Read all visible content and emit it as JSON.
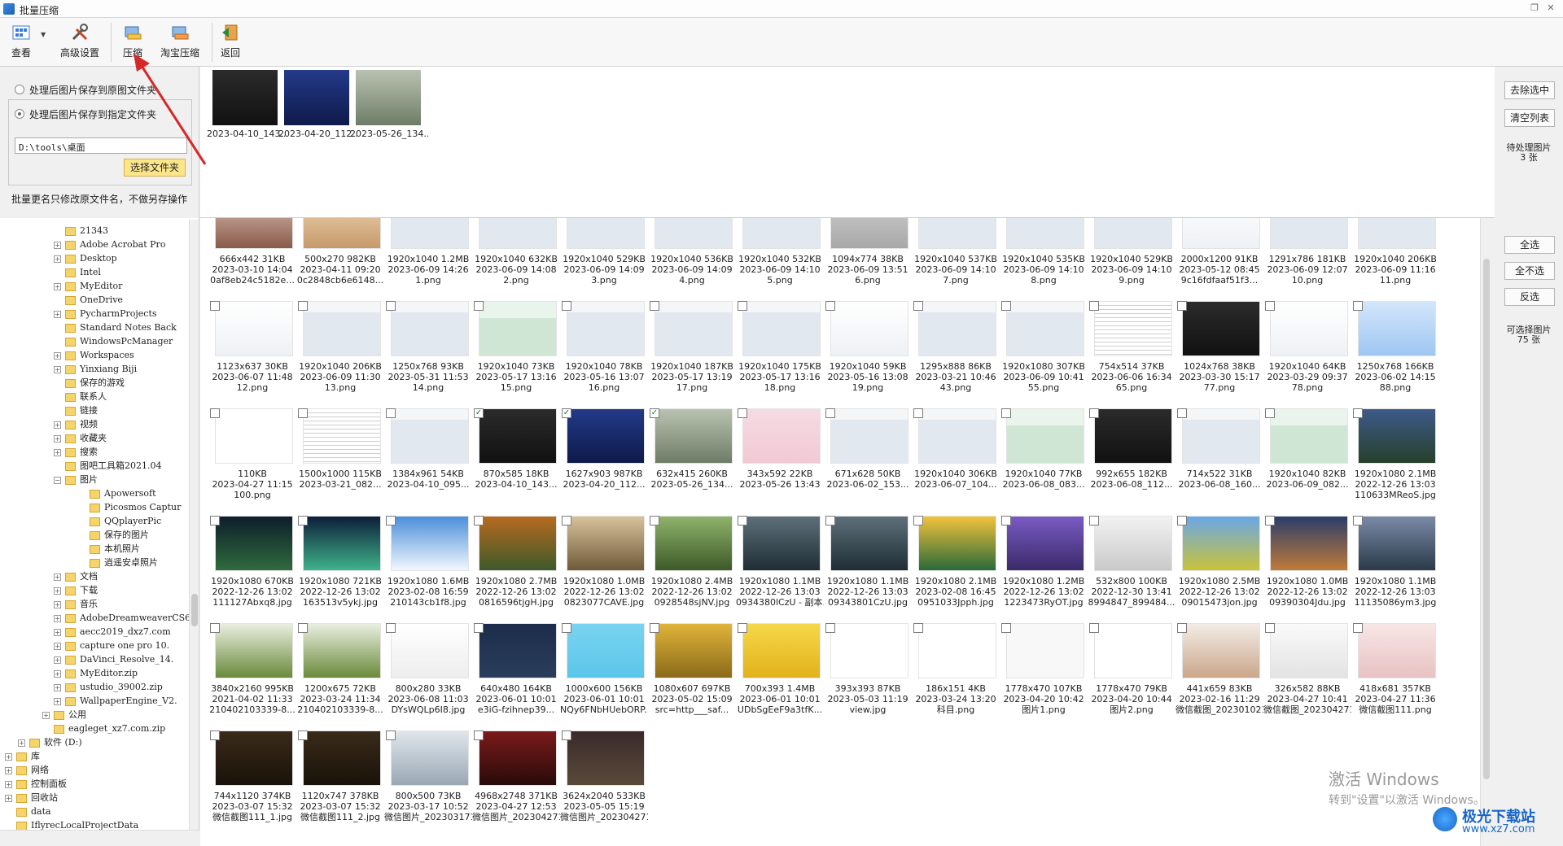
{
  "window": {
    "title": "批量压缩"
  },
  "toolbar": {
    "view_label": "查看",
    "advanced_label": "高级设置",
    "compress_label": "压缩",
    "taobao_label": "淘宝压缩",
    "back_label": "返回"
  },
  "options": {
    "save_original_label": "处理后图片保存到原图文件夹",
    "save_custom_label": "处理后图片保存到指定文件夹",
    "path_value": "D:\\tools\\桌面",
    "choose_folder_label": "选择文件夹",
    "rename_note": "批量更名只修改原文件名，不做另存操作"
  },
  "queue": {
    "items": [
      "2023-04-10_143...",
      "2023-04-20_112...",
      "2023-05-26_134..."
    ],
    "remove_selected_label": "去除选中",
    "clear_list_label": "清空列表",
    "pending_label": "待处理图片",
    "pending_count": "3 张"
  },
  "grid_controls": {
    "select_all_label": "全选",
    "select_none_label": "全不选",
    "invert_label": "反选",
    "selectable_label": "可选择图片",
    "selectable_count": "75 张"
  },
  "tree": [
    {
      "label": "21343",
      "indent": 1,
      "exp": ""
    },
    {
      "label": "Adobe Acrobat Pro",
      "indent": 1,
      "exp": "+"
    },
    {
      "label": "Desktop",
      "indent": 1,
      "exp": "+"
    },
    {
      "label": "Intel",
      "indent": 1,
      "exp": ""
    },
    {
      "label": "MyEditor",
      "indent": 1,
      "exp": "+"
    },
    {
      "label": "OneDrive",
      "indent": 1,
      "exp": ""
    },
    {
      "label": "PycharmProjects",
      "indent": 1,
      "exp": "+"
    },
    {
      "label": "Standard Notes Back",
      "indent": 1,
      "exp": ""
    },
    {
      "label": "WindowsPcManager",
      "indent": 1,
      "exp": ""
    },
    {
      "label": "Workspaces",
      "indent": 1,
      "exp": "+"
    },
    {
      "label": "Yinxiang Biji",
      "indent": 1,
      "exp": "+"
    },
    {
      "label": "保存的游戏",
      "indent": 1,
      "exp": ""
    },
    {
      "label": "联系人",
      "indent": 1,
      "exp": ""
    },
    {
      "label": "链接",
      "indent": 1,
      "exp": ""
    },
    {
      "label": "视频",
      "indent": 1,
      "exp": "+"
    },
    {
      "label": "收藏夹",
      "indent": 1,
      "exp": "+"
    },
    {
      "label": "搜索",
      "indent": 1,
      "exp": "+"
    },
    {
      "label": "图吧工具箱2021.04",
      "indent": 1,
      "exp": ""
    },
    {
      "label": "图片",
      "indent": 1,
      "exp": "-"
    },
    {
      "label": "Apowersoft",
      "indent": 2,
      "exp": ""
    },
    {
      "label": "Picosmos Captur",
      "indent": 2,
      "exp": ""
    },
    {
      "label": "QQplayerPic",
      "indent": 2,
      "exp": ""
    },
    {
      "label": "保存的图片",
      "indent": 2,
      "exp": ""
    },
    {
      "label": "本机照片",
      "indent": 2,
      "exp": ""
    },
    {
      "label": "逍遥安卓照片",
      "indent": 2,
      "exp": ""
    },
    {
      "label": "文档",
      "indent": 1,
      "exp": "+"
    },
    {
      "label": "下载",
      "indent": 1,
      "exp": "+"
    },
    {
      "label": "音乐",
      "indent": 1,
      "exp": "+"
    },
    {
      "label": "AdobeDreamweaverCS6",
      "indent": 1,
      "exp": "+"
    },
    {
      "label": "aecc2019_dxz7.com",
      "indent": 1,
      "exp": "+"
    },
    {
      "label": "capture one pro 10.",
      "indent": 1,
      "exp": "+"
    },
    {
      "label": "DaVinci_Resolve_14.",
      "indent": 1,
      "exp": "+"
    },
    {
      "label": "MyEditor.zip",
      "indent": 1,
      "exp": "+"
    },
    {
      "label": "ustudio_39002.zip",
      "indent": 1,
      "exp": "+"
    },
    {
      "label": "WallpaperEngine_V2.",
      "indent": 1,
      "exp": "+"
    },
    {
      "label": "公用",
      "indent": 0,
      "exp": "+"
    },
    {
      "label": "eagleget_xz7.com.zip",
      "indent": 0,
      "exp": ""
    },
    {
      "label": "软件 (D:)",
      "indent": -1,
      "exp": "+"
    },
    {
      "label": "库",
      "indent": -2,
      "exp": "+"
    },
    {
      "label": "网络",
      "indent": -2,
      "exp": "+"
    },
    {
      "label": "控制面板",
      "indent": -2,
      "exp": "+"
    },
    {
      "label": "回收站",
      "indent": -2,
      "exp": "+"
    },
    {
      "label": "data",
      "indent": -2,
      "exp": ""
    },
    {
      "label": "IflyrecLocalProjectData",
      "indent": -2,
      "exp": ""
    }
  ],
  "grid": [
    {
      "dim": "666x442 31KB",
      "date": "2023-03-10 14:04",
      "name": "0af8eb24c5182e...",
      "thumb": "portrait",
      "checked": false
    },
    {
      "dim": "500x270 982KB",
      "date": "2023-04-11 09:20",
      "name": "0c2848cb6e6148...",
      "thumb": "warm",
      "checked": false
    },
    {
      "dim": "1920x1040 1.2MB",
      "date": "2023-06-09 14:26",
      "name": "1.png",
      "thumb": "screen",
      "checked": false
    },
    {
      "dim": "1920x1040 632KB",
      "date": "2023-06-09 14:08",
      "name": "2.png",
      "thumb": "screen",
      "checked": false
    },
    {
      "dim": "1920x1040 529KB",
      "date": "2023-06-09 14:09",
      "name": "3.png",
      "thumb": "screen",
      "checked": false
    },
    {
      "dim": "1920x1040 536KB",
      "date": "2023-06-09 14:09",
      "name": "4.png",
      "thumb": "screen",
      "checked": false
    },
    {
      "dim": "1920x1040 532KB",
      "date": "2023-06-09 14:10",
      "name": "5.png",
      "thumb": "screen",
      "checked": false
    },
    {
      "dim": "1094x774 38KB",
      "date": "2023-06-09 13:51",
      "name": "6.png",
      "thumb": "gray",
      "checked": false
    },
    {
      "dim": "1920x1040 537KB",
      "date": "2023-06-09 14:10",
      "name": "7.png",
      "thumb": "screen",
      "checked": false
    },
    {
      "dim": "1920x1040 535KB",
      "date": "2023-06-09 14:10",
      "name": "8.png",
      "thumb": "screen",
      "checked": false
    },
    {
      "dim": "1920x1040 529KB",
      "date": "2023-06-09 14:10",
      "name": "9.png",
      "thumb": "screen",
      "checked": false
    },
    {
      "dim": "2000x1200 91KB",
      "date": "2023-05-12 08:45",
      "name": "9c16fdfaaf51f3...",
      "thumb": "white",
      "checked": false
    },
    {
      "dim": "1291x786 181KB",
      "date": "2023-06-09 12:07",
      "name": "10.png",
      "thumb": "screen",
      "checked": false
    },
    {
      "dim": "1920x1040 206KB",
      "date": "2023-06-09 11:16",
      "name": "11.png",
      "thumb": "screen",
      "checked": false
    },
    {
      "dim": "1123x637 30KB",
      "date": "2023-06-07 11:48",
      "name": "12.png",
      "thumb": "white",
      "checked": false
    },
    {
      "dim": "1920x1040 206KB",
      "date": "2023-06-09 11:30",
      "name": "13.png",
      "thumb": "screen",
      "checked": false
    },
    {
      "dim": "1250x768 93KB",
      "date": "2023-05-31 11:53",
      "name": "14.png",
      "thumb": "screen",
      "checked": false
    },
    {
      "dim": "1920x1040 73KB",
      "date": "2023-05-17 13:16",
      "name": "15.png",
      "thumb": "greenui",
      "checked": false
    },
    {
      "dim": "1920x1040 78KB",
      "date": "2023-05-16 13:07",
      "name": "16.png",
      "thumb": "screen",
      "checked": false
    },
    {
      "dim": "1920x1040 187KB",
      "date": "2023-05-17 13:19",
      "name": "17.png",
      "thumb": "screen",
      "checked": false
    },
    {
      "dim": "1920x1040 175KB",
      "date": "2023-05-17 13:16",
      "name": "18.png",
      "thumb": "screen",
      "checked": false
    },
    {
      "dim": "1920x1040 59KB",
      "date": "2023-05-16 13:08",
      "name": "19.png",
      "thumb": "white",
      "checked": false
    },
    {
      "dim": "1295x888 86KB",
      "date": "2023-03-21 10:46",
      "name": "43.png",
      "thumb": "screen",
      "checked": false
    },
    {
      "dim": "1920x1080 307KB",
      "date": "2023-06-09 10:41",
      "name": "55.png",
      "thumb": "screen",
      "checked": false
    },
    {
      "dim": "754x514 37KB",
      "date": "2023-06-06 16:34",
      "name": "65.png",
      "thumb": "doc",
      "checked": false
    },
    {
      "dim": "1024x768 38KB",
      "date": "2023-03-30 15:17",
      "name": "77.png",
      "thumb": "dark",
      "checked": false
    },
    {
      "dim": "1920x1040 64KB",
      "date": "2023-03-29 09:37",
      "name": "78.png",
      "thumb": "white",
      "checked": false
    },
    {
      "dim": "1250x768 166KB",
      "date": "2023-06-02 14:15",
      "name": "88.png",
      "thumb": "blueui",
      "checked": false
    },
    {
      "dim": "110KB",
      "date": "2023-04-27 11:15",
      "name": "100.png",
      "thumb": "blank",
      "checked": false
    },
    {
      "dim": "1500x1000 115KB",
      "date": "2023-03-21_082...",
      "name": "",
      "thumb": "doc",
      "checked": false
    },
    {
      "dim": "1384x961 54KB",
      "date": "2023-04-10_095...",
      "name": "",
      "thumb": "screen",
      "checked": false
    },
    {
      "dim": "870x585 18KB",
      "date": "2023-04-10_143...",
      "name": "",
      "thumb": "dark",
      "checked": true
    },
    {
      "dim": "1627x903 987KB",
      "date": "2023-04-20_112...",
      "name": "",
      "thumb": "navy",
      "checked": true
    },
    {
      "dim": "632x415 260KB",
      "date": "2023-05-26_134...",
      "name": "",
      "thumb": "watermark",
      "checked": true
    },
    {
      "dim": "343x592 22KB",
      "date": "2023-05-26 13:43",
      "name": "",
      "thumb": "pink",
      "checked": false
    },
    {
      "dim": "671x628 50KB",
      "date": "2023-06-02_153...",
      "name": "",
      "thumb": "screen",
      "checked": false
    },
    {
      "dim": "1920x1040 306KB",
      "date": "2023-06-07_104...",
      "name": "",
      "thumb": "screen",
      "checked": false
    },
    {
      "dim": "1920x1040 77KB",
      "date": "2023-06-08_083...",
      "name": "",
      "thumb": "greenui",
      "checked": false
    },
    {
      "dim": "992x655 182KB",
      "date": "2023-06-08_112...",
      "name": "",
      "thumb": "dark",
      "checked": false
    },
    {
      "dim": "714x522 31KB",
      "date": "2023-06-08_160...",
      "name": "",
      "thumb": "screen",
      "checked": false
    },
    {
      "dim": "1920x1040 82KB",
      "date": "2023-06-09_082...",
      "name": "",
      "thumb": "greenui",
      "checked": false
    },
    {
      "dim": "1920x1080 2.1MB",
      "date": "2022-12-26 13:03",
      "name": "110633MReoS.jpg",
      "thumb": "lake",
      "checked": false
    },
    {
      "dim": "1920x1080 670KB",
      "date": "2022-12-26 13:02",
      "name": "111127Abxq8.jpg",
      "thumb": "aurora",
      "checked": false
    },
    {
      "dim": "1920x1080 721KB",
      "date": "2022-12-26 13:02",
      "name": "163513v5ykj.jpg",
      "thumb": "aurora2",
      "checked": false
    },
    {
      "dim": "1920x1080 1.6MB",
      "date": "2023-02-08 16:59",
      "name": "210143cb1f8.jpg",
      "thumb": "clouds",
      "checked": false
    },
    {
      "dim": "1920x1080 2.7MB",
      "date": "2022-12-26 13:02",
      "name": "0816596tjgH.jpg",
      "thumb": "autumn",
      "checked": false
    },
    {
      "dim": "1920x1080 1.0MB",
      "date": "2022-12-26 13:02",
      "name": "0823077CAVE.jpg",
      "thumb": "mist",
      "checked": false
    },
    {
      "dim": "1920x1080 2.4MB",
      "date": "2022-12-26 13:02",
      "name": "0928548sjNV.jpg",
      "thumb": "green",
      "checked": false
    },
    {
      "dim": "1920x1080 1.1MB",
      "date": "2022-12-26 13:03",
      "name": "0934380lCzU - 副本.jpg",
      "thumb": "river",
      "checked": false
    },
    {
      "dim": "1920x1080 1.1MB",
      "date": "2022-12-26 13:03",
      "name": "09343801CzU.jpg",
      "thumb": "river",
      "checked": false
    },
    {
      "dim": "1920x1080 2.1MB",
      "date": "2023-02-08 16:45",
      "name": "0951033Jpph.jpg",
      "thumb": "yellow",
      "checked": false
    },
    {
      "dim": "1920x1080 1.2MB",
      "date": "2022-12-26 13:02",
      "name": "1223473RyOT.jpg",
      "thumb": "flowers",
      "checked": false
    },
    {
      "dim": "532x800 100KB",
      "date": "2022-12-30 13:41",
      "name": "8994847_899484...",
      "thumb": "person",
      "checked": false
    },
    {
      "dim": "1920x1080 2.5MB",
      "date": "2022-12-26 13:02",
      "name": "09015473jon.jpg",
      "thumb": "field",
      "checked": false
    },
    {
      "dim": "1920x1080 1.0MB",
      "date": "2022-12-26 13:02",
      "name": "09390304Jdu.jpg",
      "thumb": "city",
      "checked": false
    },
    {
      "dim": "1920x1080 1.1MB",
      "date": "2022-12-26 13:03",
      "name": "11135086ym3.jpg",
      "thumb": "sea",
      "checked": false
    },
    {
      "dim": "3840x2160 995KB",
      "date": "2021-04-02 11:33",
      "name": "210402103339-8...",
      "thumb": "daisy",
      "checked": false
    },
    {
      "dim": "1200x675 72KB",
      "date": "2023-03-24 11:34",
      "name": "210402103339-8...",
      "thumb": "daisy",
      "checked": false
    },
    {
      "dim": "800x280 33KB",
      "date": "2023-06-08 11:03",
      "name": "DYsWQLp6I8.jpg",
      "thumb": "brush",
      "checked": false
    },
    {
      "dim": "640x480 164KB",
      "date": "2023-06-01 10:01",
      "name": "e3iG-fzihnep39...",
      "thumb": "bird",
      "checked": false
    },
    {
      "dim": "1000x600 156KB",
      "date": "2023-06-01 10:01",
      "name": "NQy6FNbHUebORP...",
      "thumb": "cyan",
      "checked": false
    },
    {
      "dim": "1080x607 697KB",
      "date": "2023-05-02 15:09",
      "name": "src=http___saf...",
      "thumb": "ginkgo",
      "checked": false
    },
    {
      "dim": "700x393 1.4MB",
      "date": "2023-06-01 10:01",
      "name": "UDbSgEeF9a3tfK...",
      "thumb": "pikachu",
      "checked": false
    },
    {
      "dim": "393x393 87KB",
      "date": "2023-05-03 11:19",
      "name": "view.jpg",
      "thumb": "seal",
      "checked": false
    },
    {
      "dim": "186x151 4KB",
      "date": "2023-03-24 13:20",
      "name": "科目.png",
      "thumb": "mind",
      "checked": false
    },
    {
      "dim": "1778x470 107KB",
      "date": "2023-04-20 10:42",
      "name": "图片1.png",
      "thumb": "ghost",
      "checked": false
    },
    {
      "dim": "1778x470 79KB",
      "date": "2023-04-20 10:44",
      "name": "图片2.png",
      "thumb": "logo",
      "checked": false
    },
    {
      "dim": "441x659 83KB",
      "date": "2023-02-16 11:29",
      "name": "微信截图_2023010215453...",
      "thumb": "woman",
      "checked": false
    },
    {
      "dim": "326x582 88KB",
      "date": "2023-04-27 10:41",
      "name": "微信截图_2023042710414...",
      "thumb": "figure",
      "checked": false
    },
    {
      "dim": "418x681 357KB",
      "date": "2023-04-27 11:36",
      "name": "微信截图111.png",
      "thumb": "cartoon",
      "checked": false
    },
    {
      "dim": "744x1120 374KB",
      "date": "2023-03-07 15:32",
      "name": "微信截图111_1.jpg",
      "thumb": "leafdark",
      "checked": false
    },
    {
      "dim": "1120x747 378KB",
      "date": "2023-03-07 15:32",
      "name": "微信截图111_2.jpg",
      "thumb": "leafdark",
      "checked": false
    },
    {
      "dim": "800x500 73KB",
      "date": "2023-03-17 10:52",
      "name": "微信图片_2023031710521...",
      "thumb": "dog",
      "checked": false
    },
    {
      "dim": "4968x2748 371KB",
      "date": "2023-04-27 12:53",
      "name": "微信图片_2023042712534...",
      "thumb": "poster",
      "checked": false
    },
    {
      "dim": "3624x2040 533KB",
      "date": "2023-05-05 15:19",
      "name": "微信图片_2023042712534...",
      "thumb": "poster2",
      "checked": false
    }
  ],
  "watermark": {
    "line1": "激活 Windows",
    "line2": "转到\"设置\"以激活 Windows。",
    "site_name": "极光下载站",
    "site_url": "www.xz7.com"
  },
  "queue_thumbs": [
    "dark",
    "navy",
    "watermark"
  ]
}
